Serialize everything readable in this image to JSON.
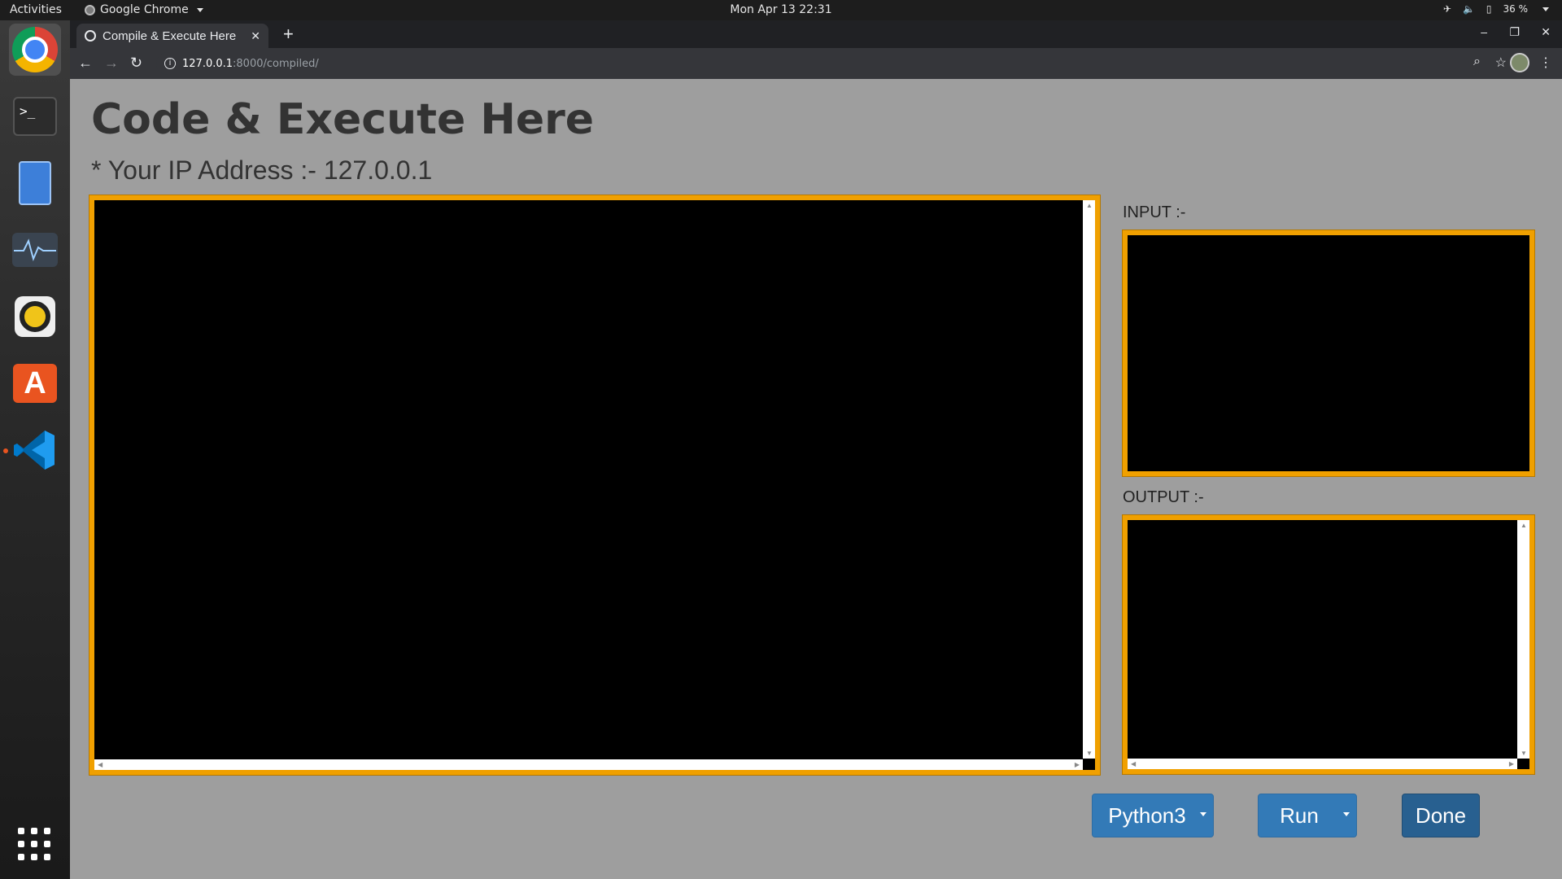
{
  "topbar": {
    "activities": "Activities",
    "app_name": "Google Chrome",
    "clock": "Mon Apr 13  22:31",
    "battery": "36 %"
  },
  "dock": {
    "items": [
      "chrome-icon",
      "terminal-icon",
      "files-icon",
      "system-monitor-icon",
      "rhythmbox-icon",
      "software-store-icon",
      "vscode-icon",
      "show-apps-icon"
    ],
    "terminal_glyph": ">_",
    "store_glyph": "A"
  },
  "browser": {
    "tab_title": "Compile & Execute Here",
    "new_tab": "+",
    "url_host": "127.0.0.1",
    "url_rest": ":8000/compiled/",
    "window_controls": [
      "–",
      "❐",
      "✕"
    ]
  },
  "page": {
    "title": "Code & Execute Here",
    "ip_line": "* Your IP Address :- 127.0.0.1",
    "code_value": "",
    "input_label": "INPUT :-",
    "input_value": "",
    "output_label": "OUTPUT :-",
    "output_value": "",
    "language_button": "Python3",
    "run_button": "Run",
    "done_button": "Done"
  },
  "colors": {
    "accent_border": "#f0a000",
    "button_primary": "#337ab7",
    "button_dark": "#286090",
    "page_bg": "#9e9e9e"
  }
}
